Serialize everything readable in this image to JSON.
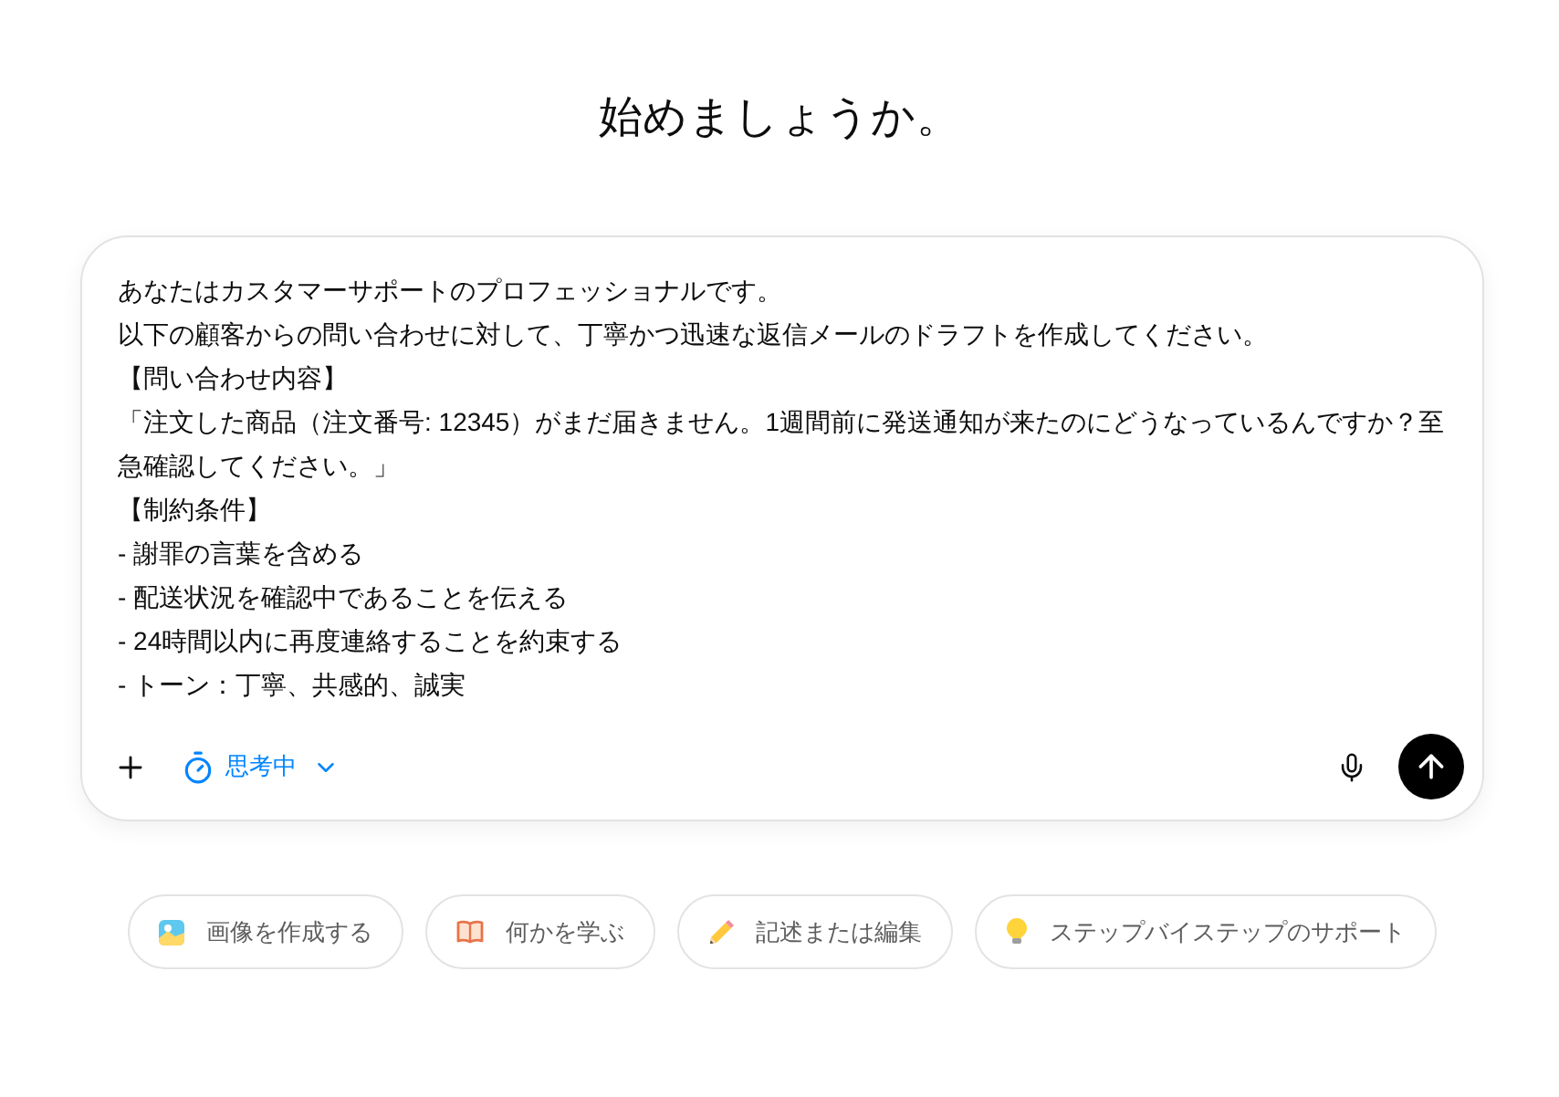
{
  "heading": "始めましょうか。",
  "composer": {
    "lines": [
      "あなたはカスタマーサポートのプロフェッショナルです。",
      "以下の顧客からの問い合わせに対して、丁寧かつ迅速な返信メールのドラフトを作成してください。",
      "【問い合わせ内容】",
      "「注文した商品（注文番号: 12345）がまだ届きません。1週間前に発送通知が来たのにどうなっているんですか？至急確認してください。」",
      "【制約条件】",
      "- 謝罪の言葉を含める",
      "- 配送状況を確認中であることを伝える",
      "- 24時間以内に再度連絡することを約束する",
      "- トーン：丁寧、共感的、誠実"
    ],
    "mode": "思考中"
  },
  "suggestions": [
    {
      "label": "画像を作成する"
    },
    {
      "label": "何かを学ぶ"
    },
    {
      "label": "記述または編集"
    },
    {
      "label": "ステップバイステップのサポート"
    }
  ]
}
